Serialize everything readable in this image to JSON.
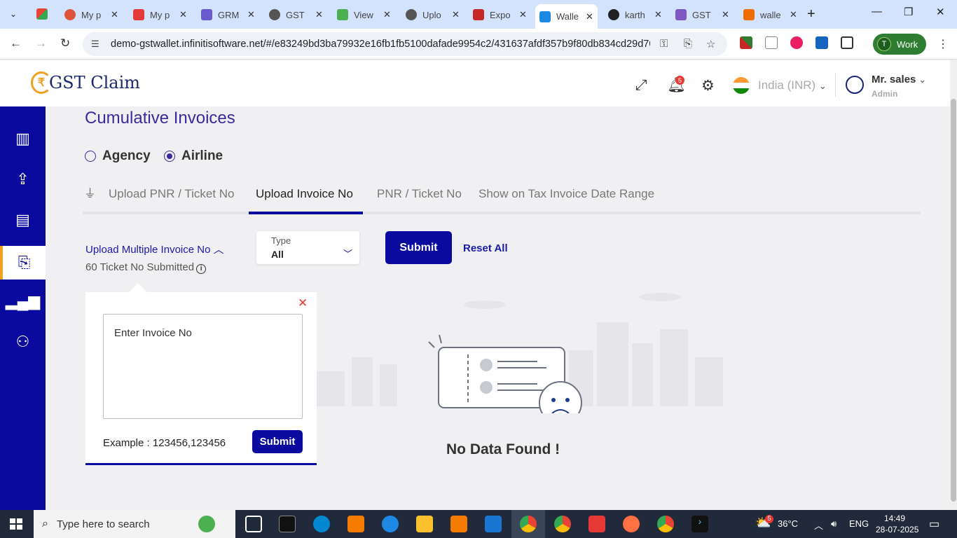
{
  "browser": {
    "tabs": [
      {
        "title": "My p",
        "color": "#e0533b"
      },
      {
        "title": "My p",
        "color": "#e53935"
      },
      {
        "title": "GRM",
        "color": "#6a5acd"
      },
      {
        "title": "GST",
        "color": "#555555"
      },
      {
        "title": "View",
        "color": "#4caf50"
      },
      {
        "title": "Uplo",
        "color": "#555555"
      },
      {
        "title": "Expo",
        "color": "#c62828"
      },
      {
        "title": "Walle",
        "color": "#1e88e5"
      },
      {
        "title": "karth",
        "color": "#222222"
      },
      {
        "title": "GST",
        "color": "#7e57c2"
      },
      {
        "title": "walle",
        "color": "#ef6c00"
      }
    ],
    "url": "demo-gstwallet.infinitisoftware.net/#/e83249bd3ba79932e16fb1fb5100dafade9954c2/431637afdf357b9f80db834cd29d70f...",
    "profile": "Work",
    "profile_initial": "T"
  },
  "header": {
    "brand": "GST Claim",
    "notification_count": "5",
    "currency": "India (INR)",
    "user_name": "Mr. sales",
    "user_role": "Admin"
  },
  "page": {
    "title": "Cumulative Invoices",
    "radio": {
      "agency": "Agency",
      "airline": "Airline",
      "selected": "airline"
    },
    "tabs": [
      "Upload PNR / Ticket No",
      "Upload Invoice No",
      "PNR / Ticket No",
      "Show on Tax Invoice Date Range"
    ],
    "active_tab": "Upload Invoice No",
    "upload_multiple": "Upload Multiple Invoice No",
    "submitted_count": "60 Ticket No Submitted",
    "type": {
      "label": "Type",
      "value": "All"
    },
    "submit": "Submit",
    "reset": "Reset All",
    "panel": {
      "placeholder": "Enter Invoice No",
      "example": "Example : 123456,123456",
      "submit": "Submit"
    },
    "no_data": "No Data Found !"
  },
  "taskbar": {
    "search_placeholder": "Type here to search",
    "weather": "36°C",
    "lang": "ENG",
    "time": "14:49",
    "date": "28-07-2025",
    "notif_count": "5"
  }
}
